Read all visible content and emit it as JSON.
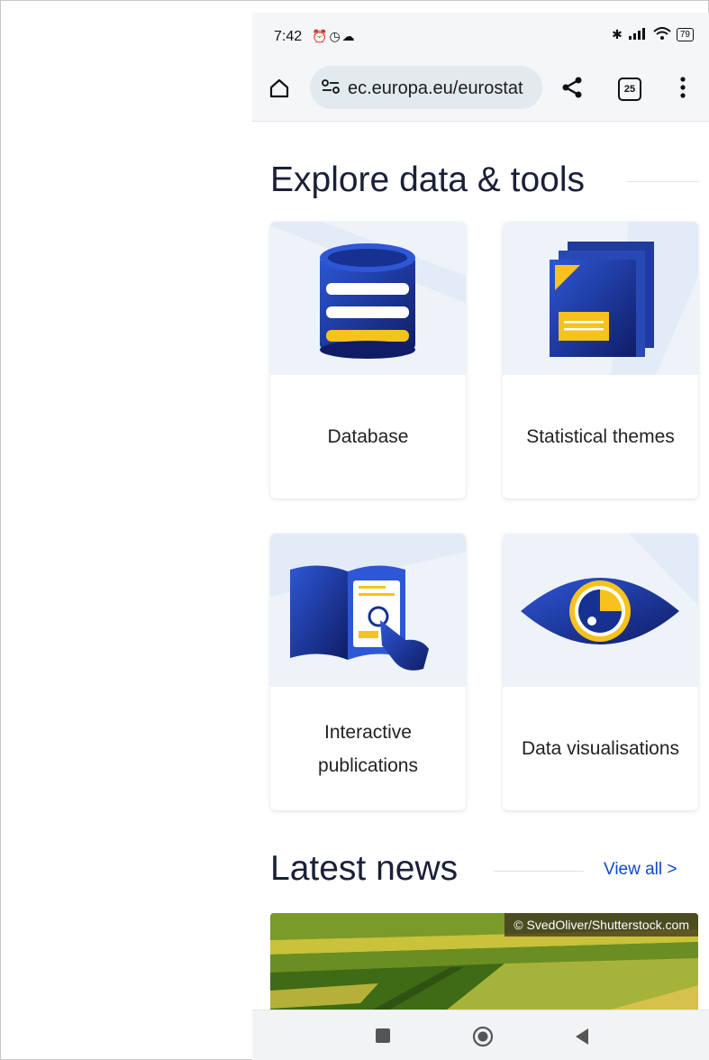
{
  "status_bar": {
    "time": "7:42",
    "left_icons": [
      "alarm-icon",
      "alarm-outline-icon",
      "cloud-icon"
    ],
    "right_icons": [
      "bluetooth-icon",
      "signal-icon",
      "wifi-icon",
      "battery-icon"
    ],
    "battery": "79"
  },
  "browser": {
    "url": "ec.europa.eu/eurostat",
    "tab_count": "25"
  },
  "explore": {
    "title": "Explore data & tools",
    "cards": [
      {
        "label": "Database",
        "icon": "database-icon"
      },
      {
        "label": "Statistical themes",
        "icon": "documents-icon"
      },
      {
        "label": "Interactive publications",
        "icon": "interactive-publication-icon"
      },
      {
        "label": "Data visualisations",
        "icon": "eye-icon"
      }
    ]
  },
  "news": {
    "title": "Latest news",
    "view_all": "View all >",
    "image_credit": "© SvedOliver/Shutterstock.com"
  },
  "colors": {
    "accent_blue": "#0e47cb",
    "navy": "#1d2f7a",
    "yellow": "#f7c21c",
    "heading": "#1a2038"
  }
}
